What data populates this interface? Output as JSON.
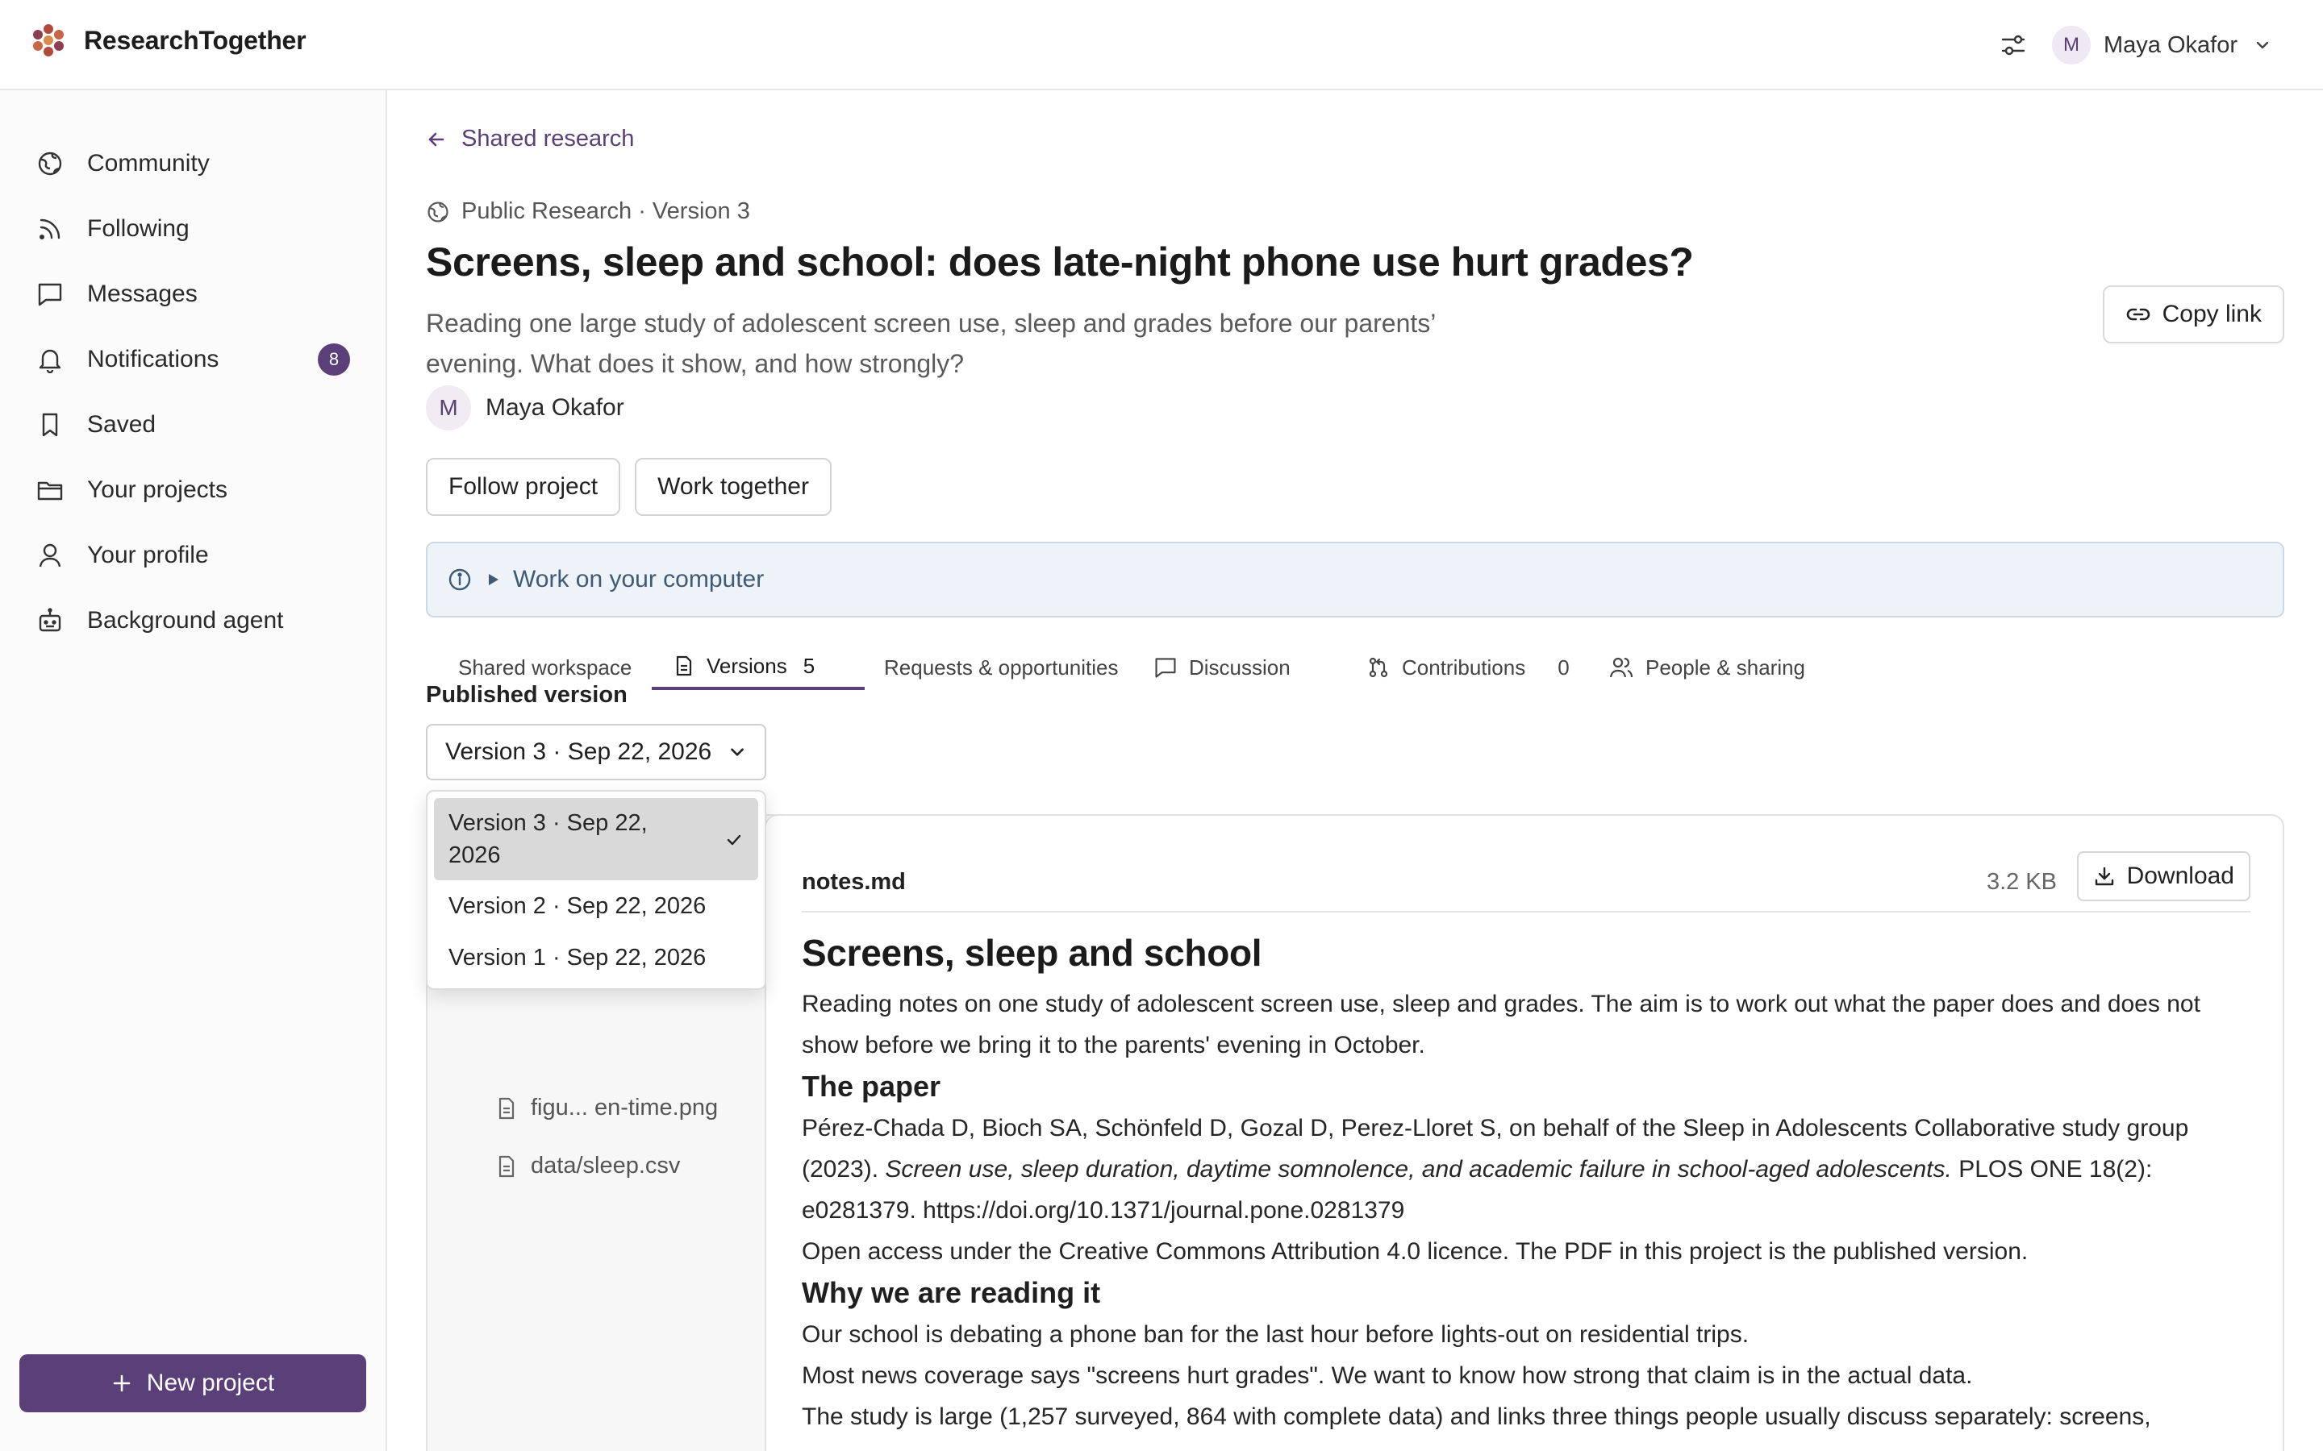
{
  "app": {
    "name": "ResearchTogether"
  },
  "header": {
    "user_initial": "M",
    "user_name": "Maya Okafor"
  },
  "sidebar": {
    "items": [
      {
        "label": "Community",
        "icon": "globe-icon"
      },
      {
        "label": "Following",
        "icon": "rss-icon"
      },
      {
        "label": "Messages",
        "icon": "message-icon"
      },
      {
        "label": "Notifications",
        "icon": "bell-icon",
        "badge": "8"
      },
      {
        "label": "Saved",
        "icon": "bookmark-icon"
      },
      {
        "label": "Your projects",
        "icon": "folder-icon"
      },
      {
        "label": "Your profile",
        "icon": "user-icon"
      },
      {
        "label": "Background agent",
        "icon": "robot-icon"
      }
    ],
    "new_project_label": "New project"
  },
  "page": {
    "back_label": "Shared research",
    "meta": "Public Research · Version 3",
    "title": "Screens, sleep and school: does late-night phone use hurt grades?",
    "description": "Reading one large study of adolescent screen use, sleep and grades before our parents’ evening. What does it show, and how strongly?",
    "author_initial": "M",
    "author_name": "Maya Okafor",
    "copy_link_label": "Copy link",
    "follow_label": "Follow project",
    "work_together_label": "Work together",
    "info_banner": "Work on your computer"
  },
  "tabs": [
    {
      "label": "Shared workspace"
    },
    {
      "label": "Versions",
      "count": "5"
    },
    {
      "label": "Requests & opportunities"
    },
    {
      "label": "Discussion"
    },
    {
      "label": "Contributions",
      "count": "0"
    },
    {
      "label": "People & sharing"
    }
  ],
  "versions": {
    "label": "Published version",
    "selected": "Version 3 · Sep 22, 2026",
    "options": [
      "Version 3 · Sep 22, 2026",
      "Version 2 · Sep 22, 2026",
      "Version 1 · Sep 22, 2026"
    ]
  },
  "files": [
    {
      "name": "figu... en-time.png"
    },
    {
      "name": "data/sleep.csv"
    }
  ],
  "document": {
    "file_name": "notes.md",
    "file_size": "3.2 KB",
    "download_label": "Download",
    "h1": "Screens, sleep and school",
    "intro": "Reading notes on one study of adolescent screen use, sleep and grades. The aim is to work out what the paper does and does not show before we bring it to the parents' evening in October.",
    "h2_paper": "The paper",
    "citation_authors": "Pérez-Chada D, Bioch SA, Schönfeld D, Gozal D, Perez-Lloret S, on behalf of the Sleep in Adolescents Collaborative study group (2023).",
    "citation_title": "Screen use, sleep duration, daytime somnolence, and academic failure in school-aged adolescents.",
    "citation_rest": "PLOS ONE 18(2): e0281379. https://doi.org/10.1371/journal.pone.0281379",
    "license": "Open access under the Creative Commons Attribution 4.0 licence. The PDF in this project is the published version.",
    "h2_why": "Why we are reading it",
    "why_1": "Our school is debating a phone ban for the last hour before lights-out on residential trips.",
    "why_2": "Most news coverage says \"screens hurt grades\". We want to know how strong that claim is in the actual data.",
    "why_3": "The study is large (1,257 surveyed, 864 with complete data) and links three things people usually discuss separately: screens,"
  },
  "colors": {
    "accent": "#5b3f78",
    "banner_bg": "#eef3f9",
    "banner_text": "#3f5a74"
  }
}
